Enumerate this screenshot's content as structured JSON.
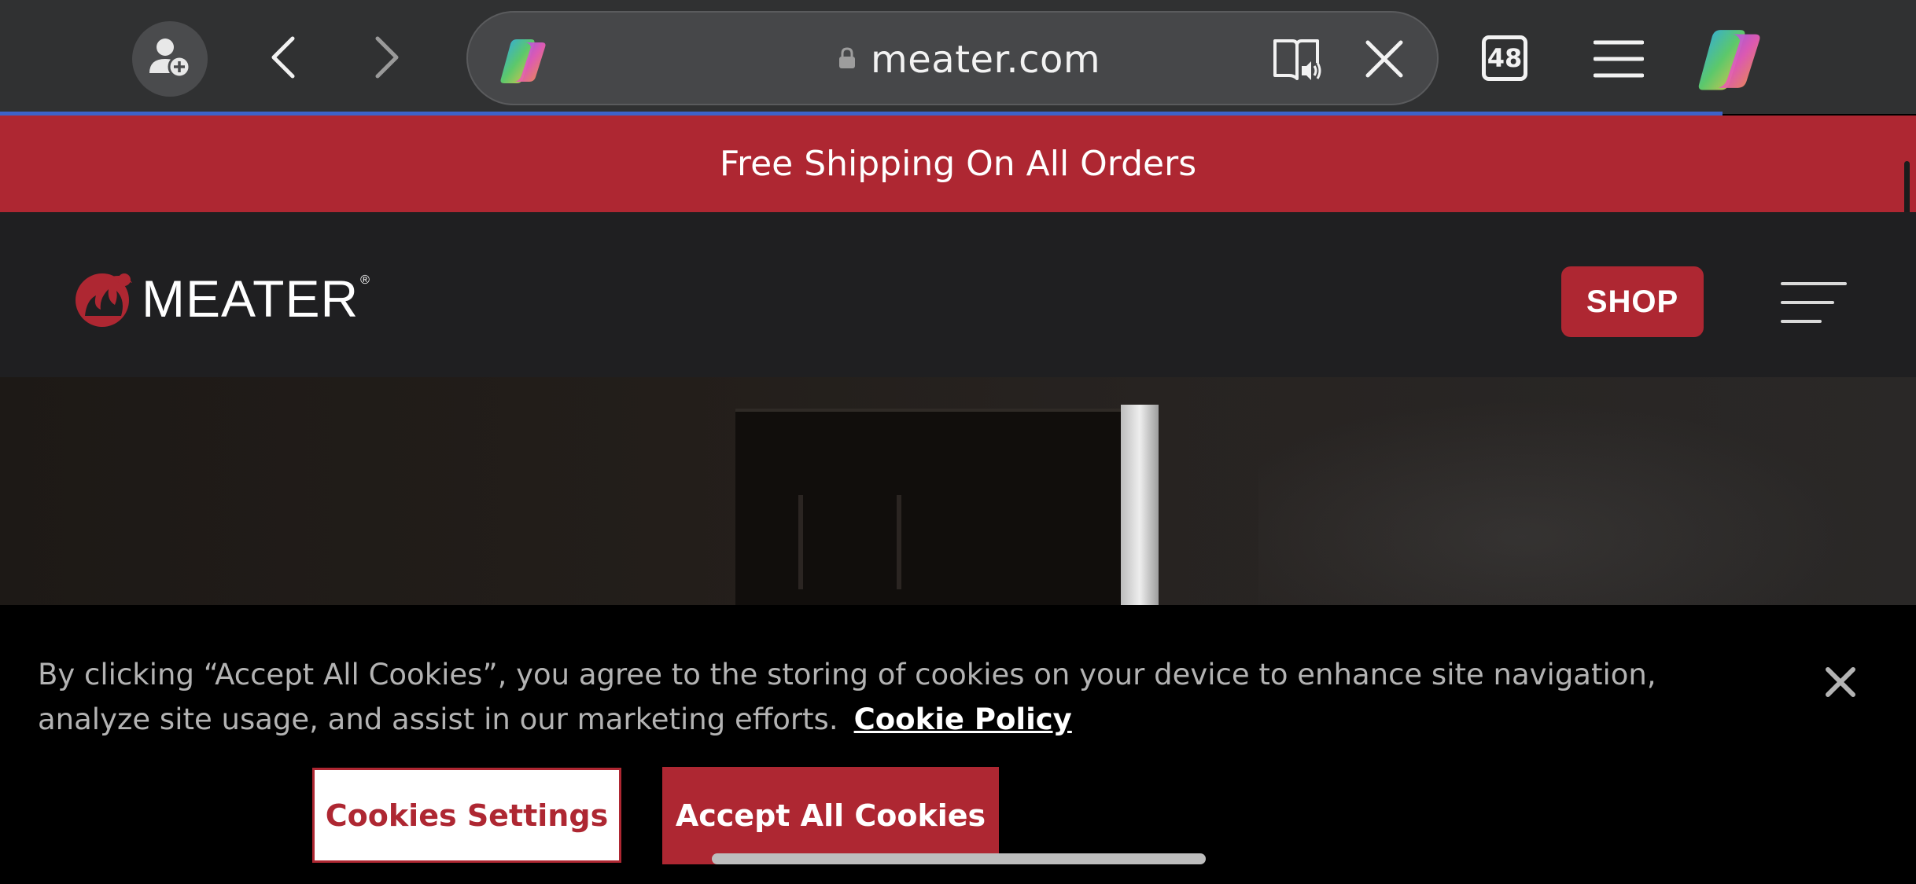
{
  "browser": {
    "url": "meater.com",
    "tab_count": "48",
    "profile_icon": "add-profile-icon",
    "back_icon": "chevron-left-icon",
    "forward_icon": "chevron-right-icon",
    "lock_icon": "lock-icon",
    "read_aloud_icon": "read-aloud-icon",
    "clear_icon": "close-icon",
    "menu_icon": "menu-icon",
    "copilot_icon": "copilot-icon"
  },
  "promo": {
    "text": "Free Shipping On All Orders"
  },
  "header": {
    "logo_text": "MEATER",
    "logo_reg": "®",
    "shop_label": "SHOP",
    "menu_icon": "hamburger-icon"
  },
  "cookie": {
    "message": "By clicking “Accept All Cookies”, you agree to the storing of cookies on your device to enhance site navigation, analyze site usage, and assist in our marketing efforts.",
    "policy_link": "Cookie Policy",
    "settings_label": "Cookies Settings",
    "accept_label": "Accept All Cookies",
    "close_icon": "close-icon"
  },
  "colors": {
    "brand_red": "#ae2732",
    "browser_bar": "#303132",
    "header_bg": "#1f1f21",
    "progress_blue": "#3d63c9"
  }
}
